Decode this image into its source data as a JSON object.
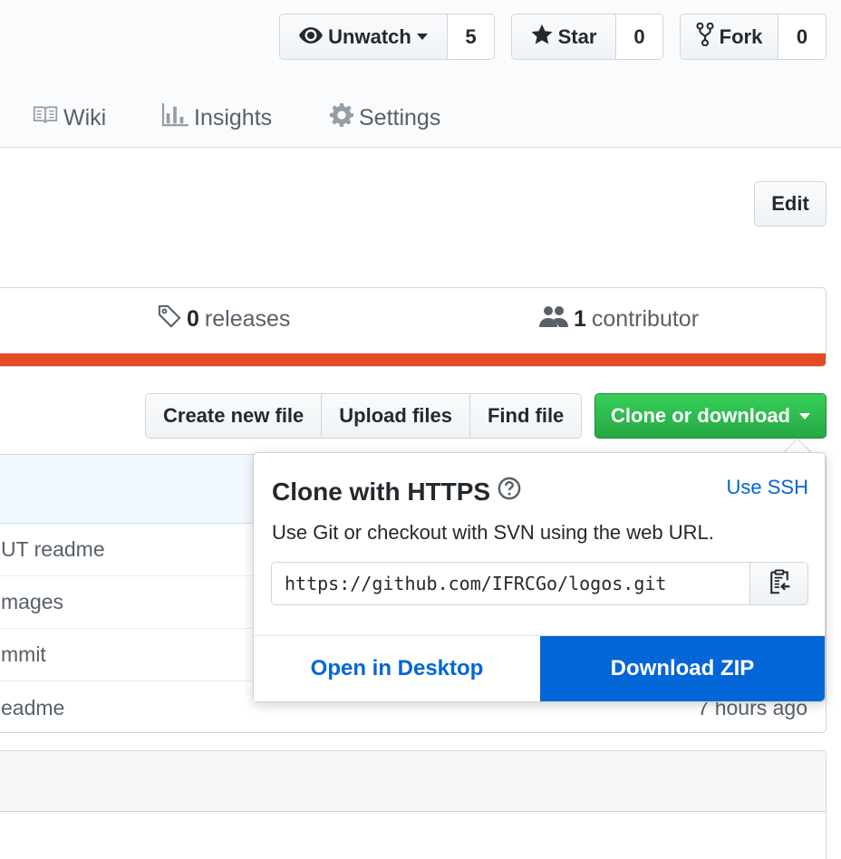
{
  "header": {
    "unwatch": {
      "label": "Unwatch",
      "count": "5"
    },
    "star": {
      "label": "Star",
      "count": "0"
    },
    "fork": {
      "label": "Fork",
      "count": "0"
    }
  },
  "nav": {
    "wiki": "Wiki",
    "insights": "Insights",
    "settings": "Settings"
  },
  "edit_label": "Edit",
  "summary": {
    "releases_count": "0",
    "releases_label": "releases",
    "contributors_count": "1",
    "contributors_label": "contributor",
    "language_color": "#e34c26"
  },
  "file_buttons": {
    "create": "Create new file",
    "upload": "Upload files",
    "find": "Find file",
    "clone": "Clone or download"
  },
  "files": [
    {
      "message": "UT readme",
      "age": ""
    },
    {
      "message": "mages",
      "age": ""
    },
    {
      "message": "mmit",
      "age": ""
    },
    {
      "message": "eadme",
      "age": "7 hours ago"
    }
  ],
  "clone_popover": {
    "title": "Clone with HTTPS",
    "use_ssh": "Use SSH",
    "description": "Use Git or checkout with SVN using the web URL.",
    "url": "https://github.com/IFRCGo/logos.git",
    "open_desktop": "Open in Desktop",
    "download_zip": "Download ZIP"
  }
}
